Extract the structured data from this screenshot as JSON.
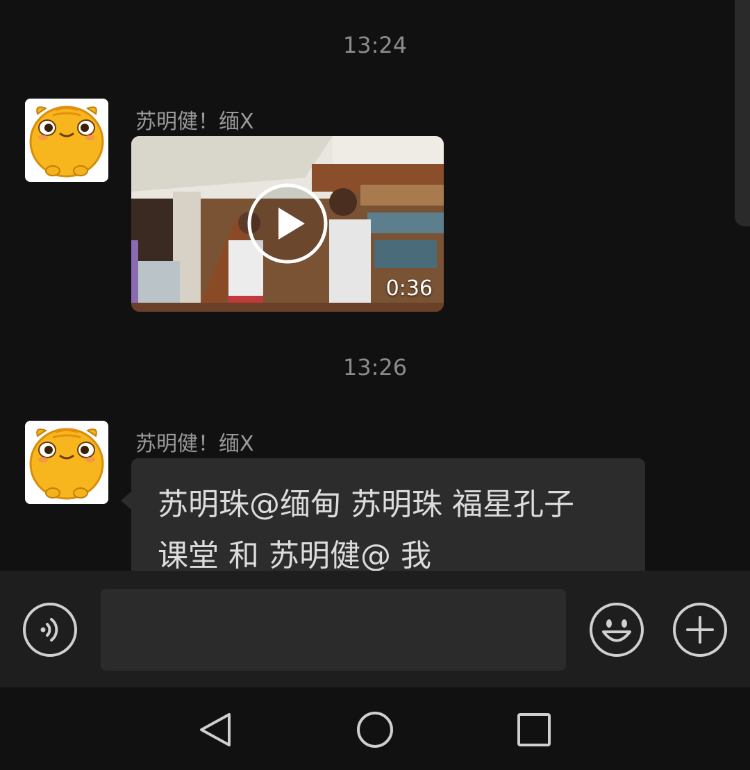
{
  "messages": [
    {
      "time": "13:24",
      "sender": "苏明健！缅X",
      "type": "video",
      "duration": "0:36"
    },
    {
      "time": "13:26",
      "sender": "苏明健！缅X",
      "type": "text",
      "text_lines": [
        "苏明珠@缅甸 苏明珠 福星孔子",
        "课堂  和  苏明健@ 我"
      ]
    }
  ],
  "input_bar": {
    "text_value": "",
    "voice_icon": "voice-icon",
    "emoji_icon": "emoji-icon",
    "plus_icon": "plus-icon"
  },
  "nav_bar": {
    "back_icon": "back-triangle-icon",
    "home_icon": "home-circle-icon",
    "recents_icon": "recents-square-icon"
  },
  "colors": {
    "background": "#111111",
    "bubble": "#2c2c2c",
    "avatar_yellow": "#f5b21a"
  }
}
